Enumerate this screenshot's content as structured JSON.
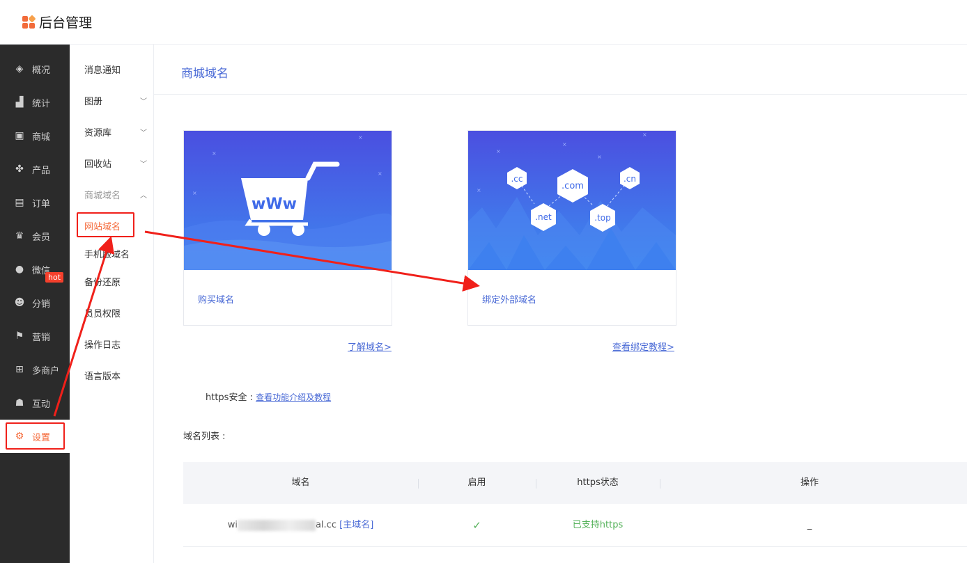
{
  "header": {
    "brand": "后台管理"
  },
  "sidebar_main": {
    "items": [
      {
        "label": "概况",
        "icon": "layers-icon"
      },
      {
        "label": "统计",
        "icon": "chart-icon"
      },
      {
        "label": "商城",
        "icon": "store-icon"
      },
      {
        "label": "产品",
        "icon": "grid-icon"
      },
      {
        "label": "订单",
        "icon": "clipboard-icon"
      },
      {
        "label": "会员",
        "icon": "crown-icon"
      },
      {
        "label": "微信",
        "icon": "wechat-icon"
      },
      {
        "label": "分销",
        "icon": "users-icon"
      },
      {
        "label": "营销",
        "icon": "flag-icon"
      },
      {
        "label": "多商户",
        "icon": "shop-add-icon"
      },
      {
        "label": "互动",
        "icon": "interact-icon"
      },
      {
        "label": "设置",
        "icon": "gear-icon"
      }
    ],
    "hot_badge": "hot"
  },
  "sidebar_sub": {
    "items": [
      {
        "label": "消息通知"
      },
      {
        "label": "图册"
      },
      {
        "label": "资源库"
      },
      {
        "label": "回收站"
      },
      {
        "label": "商城域名"
      },
      {
        "label": "网站域名"
      },
      {
        "label": "手机版域名"
      },
      {
        "label": "备份还原"
      },
      {
        "label": "员员权限"
      },
      {
        "label": "操作日志"
      },
      {
        "label": "语言版本"
      }
    ]
  },
  "main": {
    "title": "商城域名",
    "cards": [
      {
        "caption": "购买域名",
        "link": "了解域名>",
        "banner_text": "wWw"
      },
      {
        "caption": "绑定外部域名",
        "link": "查看绑定教程>",
        "badges": [
          ".cc",
          ".com",
          ".cn",
          ".net",
          ".top"
        ]
      }
    ],
    "https_label": "https安全 :",
    "https_link": "查看功能介绍及教程",
    "list_label": "域名列表 :",
    "table": {
      "headers": [
        "域名",
        "启用",
        "https状态",
        "操作"
      ],
      "rows": [
        {
          "domain_prefix": "wi",
          "domain_suffix": "al.cc",
          "tag": "[主域名]",
          "enabled": "✓",
          "https": "已支持https",
          "action": "_"
        }
      ]
    }
  },
  "colors": {
    "accent": "#f56a3a",
    "link": "#4a6ad6",
    "annotation": "#f0201a",
    "sidebar_bg": "#2b2b2b"
  }
}
